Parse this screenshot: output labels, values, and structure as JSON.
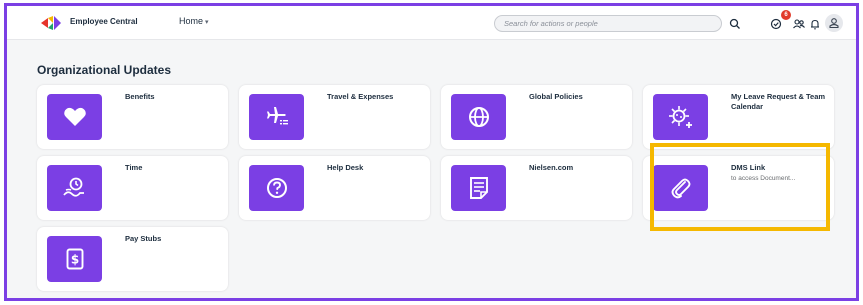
{
  "header": {
    "app_name": "Employee Central",
    "home_label": "Home",
    "search_placeholder": "Search for actions or people",
    "notification_count": "6"
  },
  "section": {
    "title": "Organizational Updates"
  },
  "tiles": [
    {
      "title": "Benefits",
      "subtitle": "",
      "icon": "heart-icon"
    },
    {
      "title": "Travel & Expenses",
      "subtitle": "",
      "icon": "airplane-icon"
    },
    {
      "title": "Global Policies",
      "subtitle": "",
      "icon": "globe-icon"
    },
    {
      "title": "My Leave Request & Team Calendar",
      "subtitle": "",
      "icon": "virus-plus-icon"
    },
    {
      "title": "Time",
      "subtitle": "",
      "icon": "time-travel-icon"
    },
    {
      "title": "Help Desk",
      "subtitle": "",
      "icon": "question-icon"
    },
    {
      "title": "Nielsen.com",
      "subtitle": "",
      "icon": "document-icon"
    },
    {
      "title": "DMS Link",
      "subtitle": "to access Document...",
      "icon": "paperclip-icon"
    },
    {
      "title": "Pay Stubs",
      "subtitle": "",
      "icon": "dollar-document-icon"
    }
  ],
  "colors": {
    "accent": "#7b3fe4",
    "highlight": "#f5b800",
    "badge": "#e13b2a"
  }
}
